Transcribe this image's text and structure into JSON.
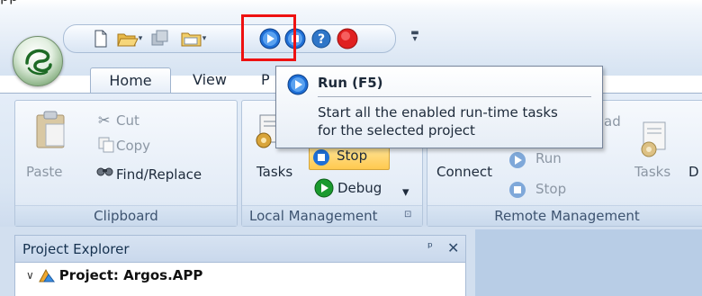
{
  "titlebar": {
    "partial_title": "pp"
  },
  "ribbon_tabs": [
    {
      "label": "Home",
      "selected": true
    },
    {
      "label": "View"
    },
    {
      "label": "P"
    }
  ],
  "groups": {
    "clipboard": {
      "label": "Clipboard",
      "paste": "Paste",
      "cut": "Cut",
      "copy": "Copy",
      "find_replace": "Find/Replace"
    },
    "local_management": {
      "label": "Local Management",
      "tasks": "Tasks",
      "stop": "Stop",
      "debug": "Debug"
    },
    "remote_management": {
      "label": "Remote Management",
      "connect": "Connect",
      "run": "Run",
      "stop": "Stop",
      "tasks": "Tasks",
      "d_partial": "D",
      "load_partial": "ad"
    }
  },
  "tooltip": {
    "title": "Run (F5)",
    "line1": "Start all the enabled run-time tasks",
    "line2": "for the selected project"
  },
  "project_explorer": {
    "title": "Project Explorer",
    "pin_glyph": "ᵖ",
    "close_glyph": "✕",
    "root_item": "Project: Argos.APP",
    "expand_glyph": "∨"
  },
  "colors": {
    "highlight": "#ee1111",
    "run_icon": "#1f6fd6",
    "help_icon": "#2f76c8",
    "stop_icon": "#e02020",
    "debug_icon": "#1a9a2e"
  }
}
